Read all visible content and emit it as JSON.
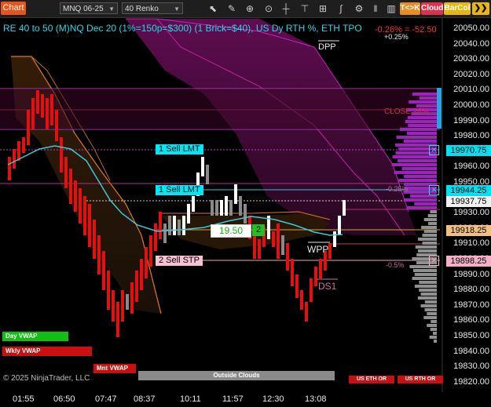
{
  "toolbar": {
    "chart_label": "Chart",
    "instrument": "MNQ 06-25",
    "bar_type": "40 Renko",
    "pills": [
      {
        "label": "T<>K",
        "color": "#e98c23"
      },
      {
        "label": "Cloud",
        "color": "#e0304c"
      },
      {
        "label": "BarCol",
        "color": "#e8b60e"
      }
    ],
    "icons": [
      "pencil-icon",
      "zoom-icon",
      "crosshair-icon",
      "text-icon",
      "line-icon",
      "ruler-icon",
      "bar-icon",
      "grid-icon",
      "chevron-icon"
    ]
  },
  "header": {
    "title": "RE 40 to 50 (M)NQ Dec 20 (1%=150p=$300) (1 Brick=$40), US Dy RTH %, ETH TPO",
    "change": "-0.26% = -52.50",
    "change_pct": "+0.25%",
    "dpp": "DPP"
  },
  "axis": {
    "ticks": [
      "20050.00",
      "20040.00",
      "20030.00",
      "20020.00",
      "20010.00",
      "20000.00",
      "19990.00",
      "19980.00",
      "19970.00",
      "19960.00",
      "19950.00",
      "19940.00",
      "19930.00",
      "19920.00",
      "19910.00",
      "19900.00",
      "19890.00",
      "19880.00",
      "19870.00",
      "19860.00",
      "19850.00",
      "19840.00",
      "19830.00",
      "19820.00"
    ],
    "price_labels": [
      {
        "text": "19970.75",
        "bg": "#00e0f0",
        "fg": "#000"
      },
      {
        "text": "19944.25",
        "bg": "#00e0f0",
        "fg": "#000"
      },
      {
        "text": "19937.75",
        "bg": "#f0f0f0",
        "fg": "#000"
      },
      {
        "text": "19918.25",
        "bg": "#f0c080",
        "fg": "#000"
      },
      {
        "text": "19898.25",
        "bg": "#f4b0c8",
        "fg": "#000"
      }
    ]
  },
  "time_axis": [
    "01:55",
    "06:50",
    "07:47",
    "08:37",
    "10:11",
    "11:57",
    "12:30",
    "13:08"
  ],
  "orders": [
    {
      "label": "1 Sell LMT",
      "bg": "#00e8f8"
    },
    {
      "label": "1 Sell LMT",
      "bg": "#00e8f8"
    },
    {
      "label": "2 Sell STP",
      "bg": "#f8c0d4"
    }
  ],
  "annotations": {
    "close": "CLOSE 20%",
    "pct_neg_025": "-0.25%",
    "pct_neg_05": "-0.5%",
    "wpp": "WPP",
    "ds1": "DS1",
    "brick_value": "19.50",
    "brick_count": "2"
  },
  "buttons": {
    "day_vwap": "Day VWAP",
    "wkly_vwap": "Wkly VWAP",
    "mnt_vwap": "Mnt VWAP",
    "outside_clouds": "Outside Clouds",
    "us_eth_or": "US ETH OR",
    "us_rth_or": "US RTH OR"
  },
  "footer": {
    "copyright": "© 2025 NinjaTrader, LLC"
  },
  "colors": {
    "up_brick": "#ffffff",
    "down_brick": "#e41010",
    "neutral_brick": "#8a8a8a",
    "vwap_line": "#3fc8d8",
    "cloud_orange": "#e07a10",
    "cloud_purple": "#b020c0",
    "profile_purple": "#a020c0",
    "profile_gray": "#909090"
  }
}
